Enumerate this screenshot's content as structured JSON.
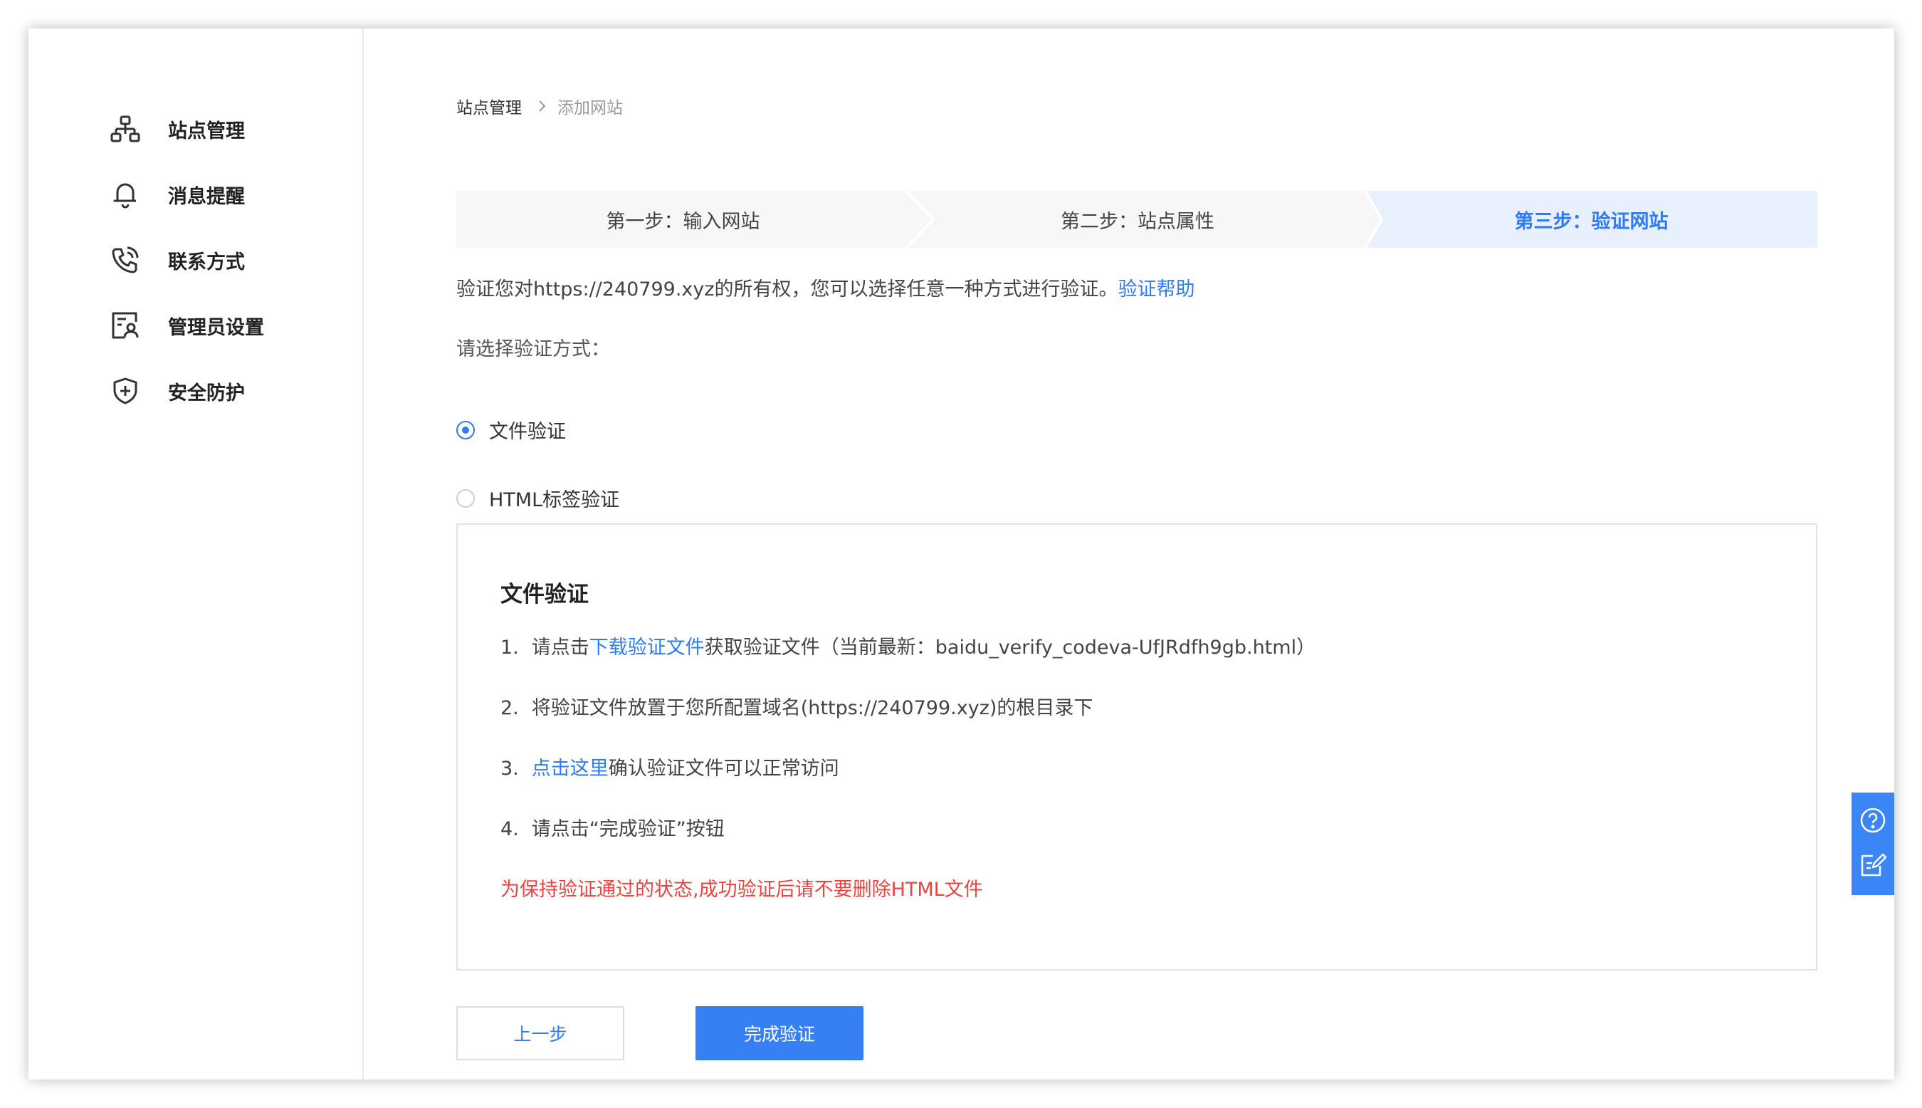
{
  "sidebar": {
    "items": [
      {
        "label": "站点管理",
        "icon": "sitemap-icon"
      },
      {
        "label": "消息提醒",
        "icon": "bell-icon"
      },
      {
        "label": "联系方式",
        "icon": "phone-icon"
      },
      {
        "label": "管理员设置",
        "icon": "admin-user-icon"
      },
      {
        "label": "安全防护",
        "icon": "shield-plus-icon"
      }
    ]
  },
  "breadcrumb": {
    "root": "站点管理",
    "current": "添加网站"
  },
  "steps": [
    {
      "label": "第一步：输入网站",
      "active": false
    },
    {
      "label": "第二步：站点属性",
      "active": false
    },
    {
      "label": "第三步：验证网站",
      "active": true
    }
  ],
  "intro": {
    "text": "验证您对https://240799.xyz的所有权，您可以选择任意一种方式进行验证。",
    "help_link": "验证帮助"
  },
  "choose_label": "请选择验证方式：",
  "methods": [
    {
      "label": "文件验证",
      "checked": true
    },
    {
      "label": "HTML标签验证",
      "checked": false
    }
  ],
  "card": {
    "title": "文件验证",
    "step1": {
      "num": "1.",
      "prefix": "请点击",
      "link": "下载验证文件",
      "suffix": "获取验证文件（当前最新：baidu_verify_codeva-UfJRdfh9gb.html）"
    },
    "step2": {
      "num": "2.",
      "text": "将验证文件放置于您所配置域名(https://240799.xyz)的根目录下"
    },
    "step3": {
      "num": "3.",
      "link": "点击这里",
      "suffix": "确认验证文件可以正常访问"
    },
    "step4": {
      "num": "4.",
      "text": "请点击“完成验证”按钮"
    },
    "warning": "为保持验证通过的状态,成功验证后请不要删除HTML文件"
  },
  "buttons": {
    "prev": "上一步",
    "done": "完成验证"
  },
  "float_panel": {
    "icons": [
      "help-circle-icon",
      "edit-note-icon"
    ]
  },
  "colors": {
    "accent": "#2f7af5",
    "warning": "#f0433f",
    "active_step_bg": "#e8f0fd",
    "float_panel": "#3a86f7"
  }
}
